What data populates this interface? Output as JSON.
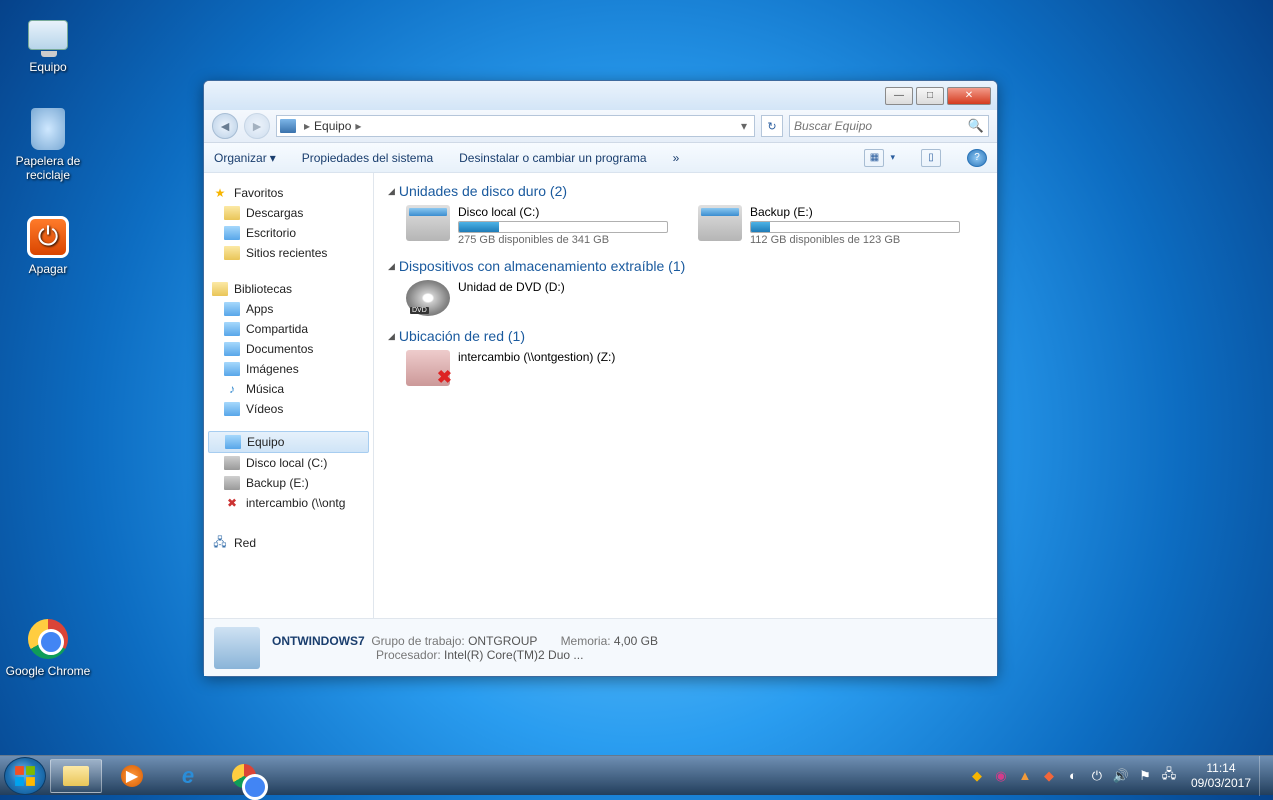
{
  "desktop": {
    "icons": [
      {
        "label": "Equipo",
        "kind": "computer"
      },
      {
        "label": "Papelera de reciclaje",
        "kind": "bin"
      },
      {
        "label": "Apagar",
        "kind": "power"
      },
      {
        "label": "Google Chrome",
        "kind": "chrome"
      }
    ]
  },
  "window": {
    "controls": {
      "min": "—",
      "max": "□",
      "close": "✕"
    },
    "breadcrumb": {
      "root_icon": "pc",
      "location": "Equipo",
      "arrow": "▸"
    },
    "refresh_glyph": "↻",
    "search": {
      "placeholder": "Buscar Equipo"
    },
    "toolbar": {
      "organize": "Organizar",
      "sys_props": "Propiedades del sistema",
      "uninstall": "Desinstalar o cambiar un programa",
      "more": "»",
      "view_glyph": "▦",
      "pane_glyph": "▯",
      "help_glyph": "?"
    },
    "sidebar": {
      "favorites": {
        "label": "Favoritos",
        "children": [
          "Descargas",
          "Escritorio",
          "Sitios recientes"
        ]
      },
      "libraries": {
        "label": "Bibliotecas",
        "children": [
          "Apps",
          "Compartida",
          "Documentos",
          "Imágenes",
          "Música",
          "Vídeos"
        ]
      },
      "computer": {
        "label": "Equipo",
        "children": [
          "Disco local (C:)",
          "Backup (E:)",
          "intercambio (\\\\ontg"
        ]
      },
      "network": {
        "label": "Red"
      }
    },
    "content": {
      "cat_hdd": "Unidades de disco duro (2)",
      "drive_c": {
        "name": "Disco local (C:)",
        "free_text": "275 GB disponibles de 341 GB",
        "used_pct": 19
      },
      "drive_e": {
        "name": "Backup (E:)",
        "free_text": "112 GB disponibles de 123 GB",
        "used_pct": 9
      },
      "cat_removable": "Dispositivos con almacenamiento extraíble (1)",
      "drive_dvd": {
        "name": "Unidad de DVD (D:)"
      },
      "cat_network": "Ubicación de red (1)",
      "drive_net": {
        "name": "intercambio (\\\\ontgestion) (Z:)"
      }
    },
    "details": {
      "name": "ONTWINDOWS7",
      "workgroup_label": "Grupo de trabajo:",
      "workgroup": "ONTGROUP",
      "memory_label": "Memoria:",
      "memory": "4,00 GB",
      "processor_label": "Procesador:",
      "processor": "Intel(R) Core(TM)2 Duo ..."
    }
  },
  "taskbar": {
    "apps": [
      "explorer",
      "media",
      "ie",
      "chrome"
    ],
    "clock": {
      "time": "11:14",
      "date": "09/03/2017"
    }
  }
}
